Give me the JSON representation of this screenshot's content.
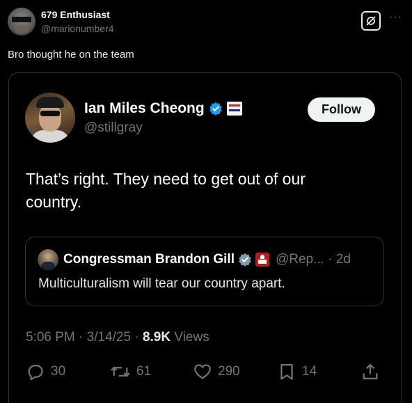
{
  "outer_post": {
    "display_name": "679 Enthusiast",
    "handle": "@marionumber4",
    "text": "Bro thought he on the team"
  },
  "header_actions": {
    "grok_icon": "grok-icon",
    "more_label": "···"
  },
  "embedded_post": {
    "display_name": "Ian Miles Cheong",
    "handle": "@stillgray",
    "follow_label": "Follow",
    "text": "That’s right. They need to get out of our country.",
    "timestamp": "5:06 PM · 3/14/25 ·",
    "views_count": "8.9K",
    "views_label": "Views"
  },
  "quoted_post": {
    "display_name": "Congressman Brandon Gill",
    "handle_date": "@Rep... · 2d",
    "text": "Multiculturalism will tear our country apart."
  },
  "actions": {
    "replies": "30",
    "reposts": "61",
    "likes": "290",
    "bookmarks": "14"
  },
  "colors": {
    "background": "#000000",
    "verified_blue": "#1d9bf0",
    "muted": "#71767b",
    "border": "#2f3336"
  }
}
